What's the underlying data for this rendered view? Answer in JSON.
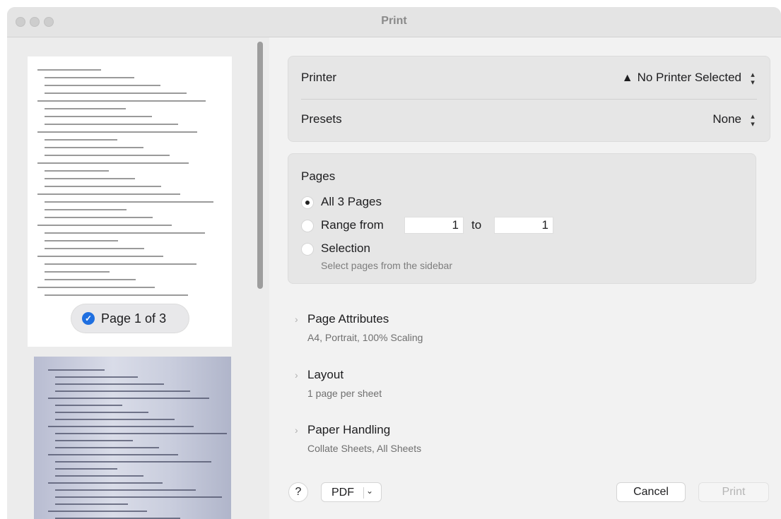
{
  "window": {
    "title": "Print"
  },
  "sidebar": {
    "page_badge": "Page 1 of 3"
  },
  "printer": {
    "label": "Printer",
    "value": "No Printer Selected"
  },
  "presets": {
    "label": "Presets",
    "value": "None"
  },
  "pages": {
    "heading": "Pages",
    "options": [
      {
        "label": "All 3 Pages",
        "selected": true
      },
      {
        "label": "Range from",
        "selected": false
      },
      {
        "label": "Selection",
        "selected": false
      }
    ],
    "range_from": "1",
    "range_to_label": "to",
    "range_to": "1",
    "selection_hint": "Select pages from the sidebar"
  },
  "sections": [
    {
      "title": "Page Attributes",
      "subtitle": "A4, Portrait, 100% Scaling"
    },
    {
      "title": "Layout",
      "subtitle": "1 page per sheet"
    },
    {
      "title": "Paper Handling",
      "subtitle": "Collate Sheets, All Sheets"
    }
  ],
  "footer": {
    "help": "?",
    "pdf": "PDF",
    "cancel": "Cancel",
    "print": "Print"
  },
  "icons": {
    "warning": "warning-triangle-icon",
    "check": "checkmark-circle-icon",
    "stepper": "up-down-chevron-icon",
    "disclosure": "chevron-right-icon",
    "dropdown": "chevron-down-icon"
  }
}
